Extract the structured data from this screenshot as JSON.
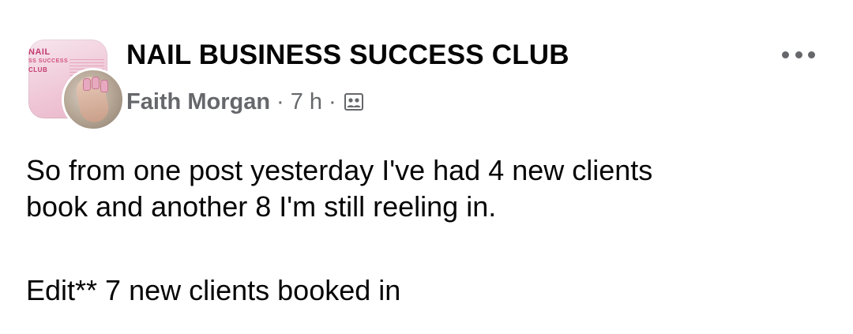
{
  "post": {
    "group_name": "NAIL BUSINESS SUCCESS CLUB",
    "author": "Faith Morgan",
    "time": "7 h",
    "separator": "·",
    "audience_icon": "group-audience-icon",
    "more_icon": "more-options-icon",
    "group_avatar_text": {
      "line_a": "NAIL",
      "line_b": "SS SUCCESS",
      "line_c": "CLUB"
    },
    "body": {
      "line1": "So from one post yesterday I've had 4 new clients",
      "line2": "book and another 8 I'm still reeling in.",
      "edit": "Edit** 7 new clients booked in"
    }
  },
  "colors": {
    "text_primary": "#050505",
    "text_secondary": "#65676b",
    "background": "#ffffff",
    "group_avatar_pink": "#f0c9d8"
  }
}
